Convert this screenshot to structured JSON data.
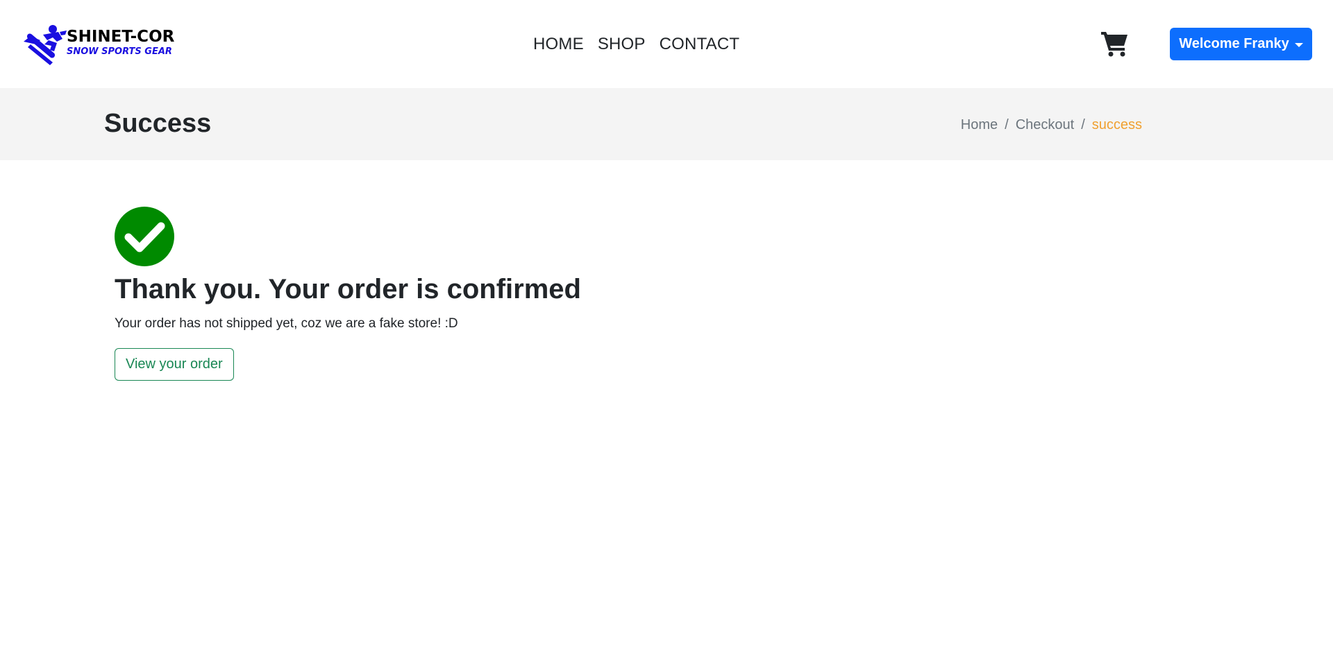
{
  "brand": {
    "name": "SHINET-CORE",
    "tagline": "SNOW SPORTS GEAR",
    "logo_color": "#1a0fe0"
  },
  "nav": {
    "links": [
      {
        "label": "HOME"
      },
      {
        "label": "SHOP"
      },
      {
        "label": "CONTACT"
      }
    ],
    "cart_icon": "shopping-cart-icon",
    "user_button": {
      "label": "Welcome Franky",
      "color": "#0d6efd"
    }
  },
  "page_header": {
    "title": "Success",
    "breadcrumb": [
      {
        "label": "Home"
      },
      {
        "label": "Checkout"
      },
      {
        "label": "success",
        "active": true,
        "color": "#f0a030"
      }
    ],
    "separator": "/"
  },
  "confirmation": {
    "icon": "check-circle-icon",
    "icon_color": "#008a00",
    "title": "Thank you. Your order is confirmed",
    "message": "Your order has not shipped yet, coz we are a fake store! :D",
    "button_label": "View your order",
    "button_color": "#198754"
  }
}
